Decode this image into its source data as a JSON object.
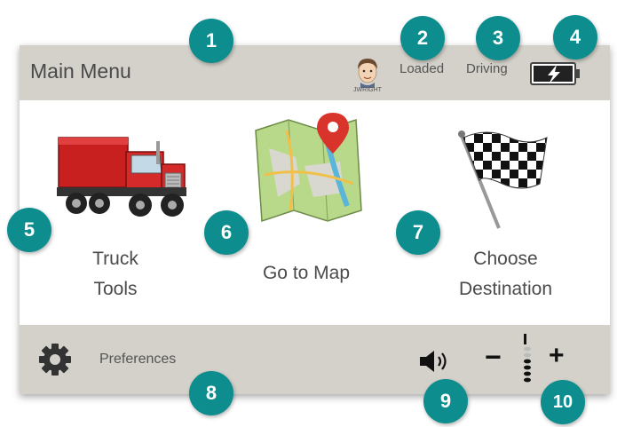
{
  "header": {
    "title": "Main Menu",
    "avatar_name": "JWRIGHT",
    "load_status": "Loaded",
    "drive_status": "Driving",
    "battery_icon": "battery-charging-icon"
  },
  "tiles": [
    {
      "label": "Truck Tools",
      "label_lines": [
        "Truck",
        "Tools"
      ],
      "icon": "truck-icon"
    },
    {
      "label": "Go to Map",
      "label_lines": [
        "Go to Map"
      ],
      "icon": "map-icon"
    },
    {
      "label": "Choose Destination",
      "label_lines": [
        "Choose",
        "Destination"
      ],
      "icon": "checkered-flag-icon"
    }
  ],
  "footer": {
    "preferences_label": "Preferences",
    "preferences_icon": "gear-icon",
    "volume_icon": "speaker-icon",
    "volume_minus": "−",
    "volume_plus": "+"
  },
  "callouts": [
    "1",
    "2",
    "3",
    "4",
    "5",
    "6",
    "7",
    "8",
    "9",
    "10"
  ],
  "colors": {
    "bar": "#d3d1c9",
    "callout": "#0d8d8e",
    "truck": "#d42a2a",
    "pin": "#d9342b"
  }
}
